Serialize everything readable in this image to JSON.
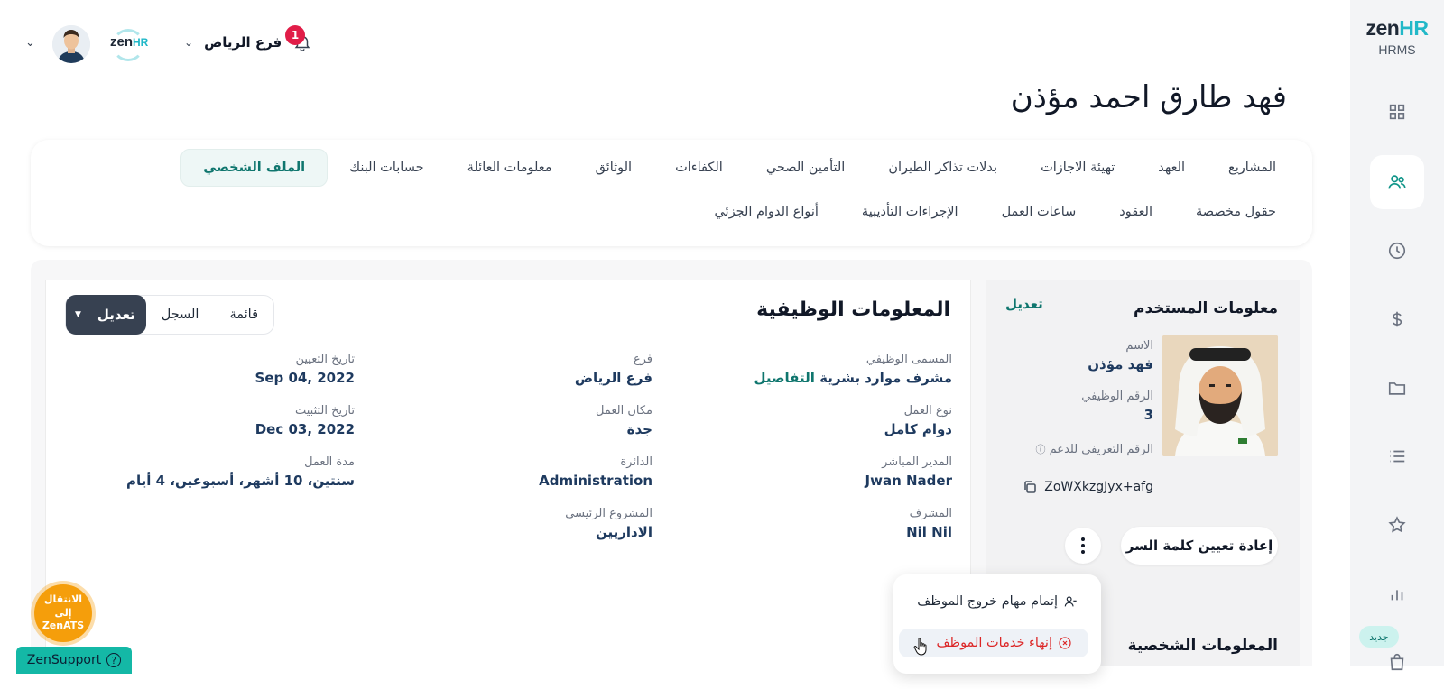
{
  "sidebar": {
    "logo_main": "zen",
    "logo_accent": "HR",
    "logo_sub": "HRMS",
    "items": [
      {
        "icon": "grid-icon"
      },
      {
        "icon": "users-icon",
        "active": true
      },
      {
        "icon": "clock-icon"
      },
      {
        "icon": "dollar-icon"
      },
      {
        "icon": "folder-icon"
      },
      {
        "icon": "list-icon"
      },
      {
        "icon": "star-icon"
      },
      {
        "icon": "bar-chart-icon"
      },
      {
        "icon": "bag-icon"
      }
    ],
    "new_badge": "جديد"
  },
  "header": {
    "branch": "فرع الرياض",
    "notification_count": "1",
    "company_logo_main": "zen",
    "company_logo_accent": "HR"
  },
  "page_title": "فهد طارق احمد مؤذن",
  "tabs_row1": [
    "الملف الشخصي",
    "حسابات البنك",
    "معلومات العائلة",
    "الوثائق",
    "الكفاءات",
    "التأمين الصحي",
    "بدلات تذاكر الطيران",
    "تهيئة الاجازات",
    "العهد",
    "المشاريع"
  ],
  "tabs_row2": [
    "أنواع الدوام الجزئي",
    "الإجراءات التأديبية",
    "ساعات العمل",
    "العقود",
    "حقول مخصصة"
  ],
  "user_card": {
    "title": "معلومات المستخدم",
    "edit": "تعديل",
    "name_label": "الاسم",
    "name_value": "فهد مؤذن",
    "id_label": "الرقم الوظيفي",
    "id_value": "3",
    "support_label": "الرقم التعريفي للدعم",
    "support_info_icon": "ⓘ",
    "support_code": "ZoWXkzgJyx+afg",
    "reset_password": "إعادة تعيين كلمة السر",
    "personal_info_title": "المعلومات الشخصية"
  },
  "job_card": {
    "title": "المعلومات الوظيفية",
    "btn_list": "قائمة",
    "btn_history": "السجل",
    "btn_edit": "تعديل",
    "fields": {
      "job_title_label": "المسمى الوظيفي",
      "job_title_value_a": "مشرف موارد بشرية",
      "job_title_value_link": "التفاصيل",
      "branch_label": "فرع",
      "branch_value": "فرع الرياض",
      "hire_date_label": "تاريخ التعيين",
      "hire_date_value": "Sep 04, 2022",
      "work_type_label": "نوع العمل",
      "work_type_value": "دوام كامل",
      "work_place_label": "مكان العمل",
      "work_place_value": "جدة",
      "confirm_date_label": "تاريخ التثبيت",
      "confirm_date_value": "Dec 03, 2022",
      "manager_label": "المدير المباشر",
      "manager_value": "Jwan Nader",
      "department_label": "الدائرة",
      "department_value": "Administration",
      "duration_label": "مدة العمل",
      "duration_value": "سنتين، 10 أشهر، أسبوعين، 4 أيام",
      "supervisor_label": "المشرف",
      "supervisor_value": "Nil Nil",
      "main_project_label": "المشروع الرئيسي",
      "main_project_value": "الاداريين"
    }
  },
  "dropdown": {
    "item1": "إتمام مهام خروج الموظف",
    "item2": "إنهاء خدمات الموظف"
  },
  "floating": {
    "ats_line1": "الانتقال إلى",
    "ats_line2": "ZenATS",
    "support": "ZenSupport",
    "support_icon": "?"
  },
  "colors": {
    "accent": "#0f766e",
    "brand_cyan": "#22b8c8",
    "danger": "#dc2626",
    "badge_red": "#e11d48",
    "ats_orange": "#f59e0b"
  }
}
